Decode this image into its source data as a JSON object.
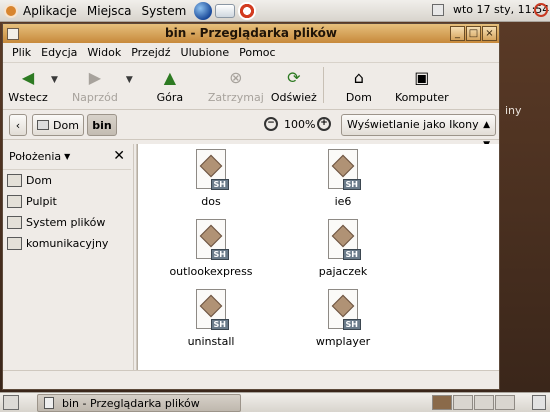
{
  "top_panel": {
    "menus": [
      "Aplikacje",
      "Miejsca",
      "System"
    ],
    "clock": "wto 17 sty, 11:54"
  },
  "desktop": {
    "peek_text": "iny"
  },
  "window": {
    "title": "bin - Przeglądarka plików",
    "menu": [
      "Plik",
      "Edycja",
      "Widok",
      "Przejdź",
      "Ulubione",
      "Pomoc"
    ],
    "toolbar": {
      "back": "Wstecz",
      "forward": "Naprzód",
      "up": "Góra",
      "stop": "Zatrzymaj",
      "reload": "Odśwież",
      "home": "Dom",
      "computer": "Komputer"
    },
    "location": {
      "crumbs": [
        "Dom",
        "bin"
      ],
      "zoom": "100%",
      "view_mode": "Wyświetlanie jako Ikony"
    },
    "sidepane": {
      "title": "Położenia",
      "places": [
        "Dom",
        "Pulpit",
        "System plików",
        "komunikacyjny"
      ]
    },
    "files": [
      {
        "name": "dos",
        "badge": "SH"
      },
      {
        "name": "ie6",
        "badge": "SH"
      },
      {
        "name": "outlookexpress",
        "badge": "SH"
      },
      {
        "name": "pajaczek",
        "badge": "SH"
      },
      {
        "name": "uninstall",
        "badge": "SH"
      },
      {
        "name": "wmplayer",
        "badge": "SH"
      }
    ]
  },
  "bottom_panel": {
    "task_title": "bin - Przeglądarka plików"
  }
}
